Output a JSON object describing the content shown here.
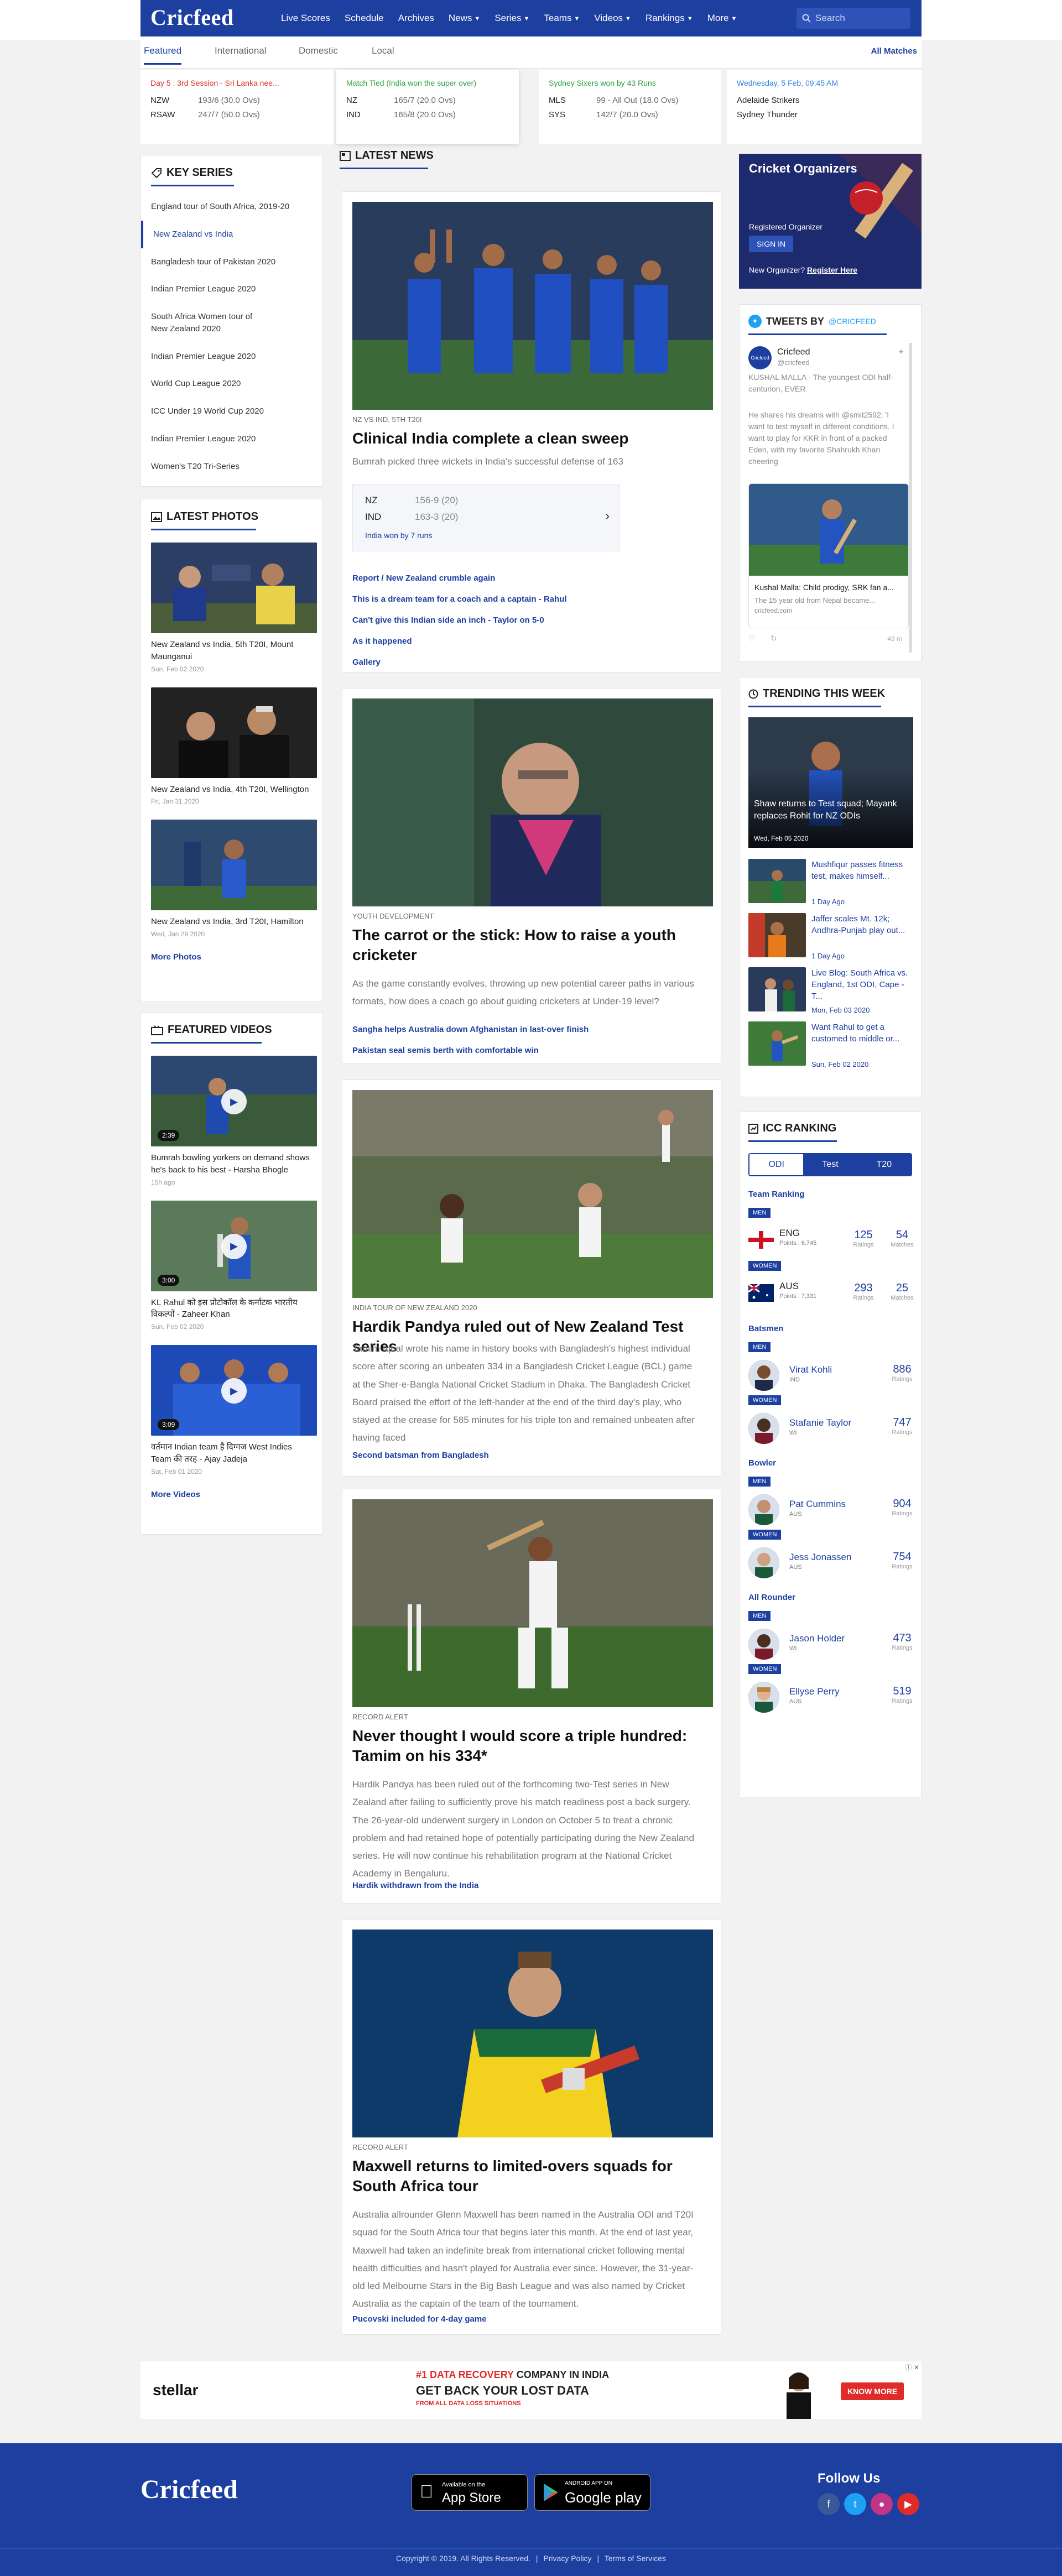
{
  "brand": {
    "logo": "Cricfeed"
  },
  "nav": {
    "items": [
      "Live Scores",
      "Schedule",
      "Archives",
      "News",
      "Series",
      "Teams",
      "Videos",
      "Rankings",
      "More"
    ],
    "search_placeholder": "Search"
  },
  "tabs": {
    "items": [
      "Featured",
      "International",
      "Domestic",
      "Local"
    ],
    "all_matches": "All Matches"
  },
  "scores": [
    {
      "status": "Day 5 : 3rd Session - Sri Lanka nee...",
      "status_color": "#e02b2b",
      "rows": [
        [
          "NZW",
          "193/6 (30.0 Ovs)"
        ],
        [
          "RSAW",
          "247/7 (50.0 Ovs)"
        ]
      ]
    },
    {
      "status": "Match Tied (India won the super over)",
      "status_color": "#2ea043",
      "rows": [
        [
          "NZ",
          "165/7 (20.0 Ovs)"
        ],
        [
          "IND",
          "165/8 (20.0 Ovs)"
        ]
      ]
    },
    {
      "status": "Sydney Sixers won by 43 Runs",
      "status_color": "#2ea043",
      "rows": [
        [
          "MLS",
          "99 - All Out (18.0 Ovs)"
        ],
        [
          "SYS",
          "142/7 (20.0 Ovs)"
        ]
      ]
    },
    {
      "status": "Wednesday, 5 Feb, 09:45 AM",
      "status_color": "#2d7fe0",
      "rows": [
        [
          "Adelaide Strikers",
          ""
        ],
        [
          "Sydney Thunder",
          ""
        ]
      ]
    }
  ],
  "key_series": {
    "title": "KEY SERIES",
    "items": [
      "England tour of South Africa, 2019-20",
      "New Zealand vs India",
      "Bangladesh tour of Pakistan 2020",
      "Indian Premier League 2020",
      "South Africa Women tour of New Zealand 2020",
      "Indian Premier League 2020",
      "World Cup League 2020",
      "ICC Under 19 World Cup 2020",
      "Indian Premier League 2020",
      "Women's T20 Tri-Series"
    ]
  },
  "latest_photos": {
    "title": "LATEST PHOTOS",
    "items": [
      {
        "caption": "New Zealand vs India, 5th T20I, Mount Maunganui",
        "date": "Sun, Feb 02 2020"
      },
      {
        "caption": "New Zealand vs India, 4th T20I, Wellington",
        "date": "Fri, Jan 31 2020"
      },
      {
        "caption": "New Zealand vs India, 3rd T20I, Hamilton",
        "date": "Wed, Jan 29 2020"
      }
    ],
    "more": "More Photos"
  },
  "featured_videos": {
    "title": "FEATURED VIDEOS",
    "items": [
      {
        "caption": "Bumrah bowling yorkers on demand shows he's back to his best - Harsha Bhogle",
        "date": "15h ago",
        "duration": "2:39"
      },
      {
        "caption": "KL Rahul को इस प्रोटोकॉल के कर्नाटक भारतीय विकल्पों - Zaheer Khan",
        "date": "Sun, Feb 02 2020",
        "duration": "3:00"
      },
      {
        "caption": "वर्तमान Indian team है दिग्गज West Indies Team की तरह - Ajay Jadeja",
        "date": "Sat, Feb 01 2020",
        "duration": "3:09"
      }
    ],
    "more": "More Videos"
  },
  "latest_news": {
    "title": "LATEST NEWS",
    "articles": [
      {
        "kicker": "NZ VS IND, 5TH T20I",
        "title": "Clinical India complete a clean sweep",
        "desc": "Bumrah picked three wickets in India's successful defense of 163",
        "scorecard": {
          "rows": [
            [
              "NZ",
              "156-9 (20)"
            ],
            [
              "IND",
              "163-3 (20)"
            ]
          ],
          "result": "India won by 7 runs"
        },
        "links": [
          "Report / New Zealand crumble again",
          "This is a dream team for a coach and a captain - Rahul",
          "Can't give this Indian side an inch - Taylor on 5-0",
          "As it happened",
          "Gallery"
        ]
      },
      {
        "kicker": "YOUTH DEVELOPMENT",
        "title": "The carrot or the stick: How to raise a youth cricketer",
        "desc": "As the game constantly evolves, throwing up new potential career paths in various formats, how does a coach go about guiding cricketers at Under-19 level?",
        "links": [
          "Sangha helps Australia down Afghanistan in last-over finish",
          "Pakistan seal semis berth with comfortable win"
        ]
      },
      {
        "kicker": "INDIA TOUR OF NEW ZEALAND 2020",
        "title": "Hardik Pandya ruled out of New Zealand Test series",
        "desc": "Tamim Iqbal wrote his name in history books with Bangladesh's highest individual score after scoring an unbeaten 334 in a Bangladesh Cricket League (BCL) game at the Sher-e-Bangla National Cricket Stadium in Dhaka. The Bangladesh Cricket Board praised the effort of the left-hander at the end of the third day's play, who stayed at the crease for 585 minutes for his triple ton and remained unbeaten after having faced",
        "links": [
          "Second batsman from Bangladesh"
        ]
      },
      {
        "kicker": "RECORD ALERT",
        "title": "Never thought I would score a triple hundred: Tamim on his 334*",
        "desc": "Hardik Pandya has been ruled out of the forthcoming two-Test series in New Zealand after failing to sufficiently prove his match readiness post a back surgery. The 26-year-old underwent surgery in London on October 5 to treat a chronic problem and had retained hope of potentially participating during the New Zealand series. He will now continue his rehabilitation program at the National Cricket Academy in Bengaluru.",
        "links": [
          "Hardik  withdrawn from the India"
        ]
      },
      {
        "kicker": "RECORD ALERT",
        "title": "Maxwell returns to limited-overs squads for South Africa tour",
        "desc": "Australia allrounder Glenn Maxwell has been named in the Australia ODI and T20I squad for the South Africa tour that begins later this month. At the end of last year, Maxwell had taken an indefinite break from international cricket following mental health difficulties and hasn't played for Australia ever since. However, the 31-year-old led Melbourne Stars in the Big Bash League and was also named by Cricket Australia as the captain of the team of the tournament.",
        "links": [
          "Pucovski included for 4-day game"
        ]
      }
    ]
  },
  "organizers": {
    "title": "Cricket Organizers",
    "registered": "Registered Organizer",
    "sign_in": "SIGN IN",
    "new_organizer": "New Organizer?",
    "register": "Register Here"
  },
  "tweets": {
    "title": "TWEETS BY",
    "handle": "@CRICFEED",
    "account_name": "Cricfeed",
    "account_handle": "@cricfeed",
    "tweet_text1": "KUSHAL MALLA - The youngest ODI half-centurion, EVER",
    "tweet_text2": "He shares his dreams with @smit2592: 'I want to test myself in different conditions. I want to play for KKR in front of a packed Eden, with my favorite Shahrukh Khan cheering",
    "card_title": "Kushal Malla: Child prodigy, SRK fan a...",
    "card_desc": "The 15 year old from Nepal became...",
    "card_site": "cricfeed.com",
    "time": "43 m"
  },
  "trending": {
    "title": "TRENDING THIS WEEK",
    "feature": {
      "title": "Shaw returns to Test squad; Mayank replaces Rohit for NZ ODIs",
      "date": "Wed, Feb 05 2020"
    },
    "items": [
      {
        "title": "Mushfiqur passes fitness test, makes himself...",
        "date": "1 Day Ago"
      },
      {
        "title": "Jaffer scales Mt. 12k; Andhra-Punjab play out...",
        "date": "1 Day Ago"
      },
      {
        "title": "Live Blog: South Africa vs. England, 1st ODI, Cape -T...",
        "date": "Mon, Feb 03 2020"
      },
      {
        "title": "Want Rahul to get a customed to middle or...",
        "date": "Sun, Feb 02 2020"
      }
    ]
  },
  "icc_ranking": {
    "title": "ICC RANKING",
    "tabs": [
      "ODI",
      "Test",
      "T20"
    ],
    "team_ranking": "Team Ranking",
    "men": "MEN",
    "women": "WOMEN",
    "ratings": "Ratings",
    "matches": "Matches",
    "teams": [
      {
        "name": "ENG",
        "points": "Points : 6,745",
        "rating": "125",
        "matches": "54"
      },
      {
        "name": "AUS",
        "points": "Points : 7,331",
        "rating": "293",
        "matches": "25"
      }
    ],
    "batsmen_label": "Batsmen",
    "batsmen": [
      {
        "name": "Virat Kohli",
        "country": "IND",
        "rating": "886"
      },
      {
        "name": "Stafanie Taylor",
        "country": "WI",
        "rating": "747"
      }
    ],
    "bowler_label": "Bowler",
    "bowlers": [
      {
        "name": "Pat Cummins",
        "country": "AUS",
        "rating": "904"
      },
      {
        "name": "Jess Jonassen",
        "country": "AUS",
        "rating": "754"
      }
    ],
    "allrounder_label": "All Rounder",
    "allrounders": [
      {
        "name": "Jason Holder",
        "country": "WI",
        "rating": "473"
      },
      {
        "name": "Ellyse Perry",
        "country": "AUS",
        "rating": "519"
      }
    ]
  },
  "ad": {
    "brand": "stellar",
    "line1_a": "#1 DATA RECOVERY",
    "line1_b": " COMPANY IN INDIA",
    "line2_a": "GET BACK YOUR ",
    "line2_b": "LOST DATA",
    "line3": "FROM ALL DATA LOSS SITUATIONS",
    "cta": "KNOW MORE"
  },
  "footer": {
    "logo": "Cricfeed",
    "appstore_small": "Available on the",
    "appstore": "App Store",
    "googleplay_small": "ANDROID APP ON",
    "googleplay": "Google play",
    "follow": "Follow Us",
    "copyright": "Copyright © 2019. All Rights Reserved.",
    "privacy": "Privacy Policy",
    "terms": "Terms of Services"
  },
  "colors": {
    "brand_blue": "#1d3fa0",
    "live_red": "#e02b2b",
    "result_green": "#2ea043"
  }
}
